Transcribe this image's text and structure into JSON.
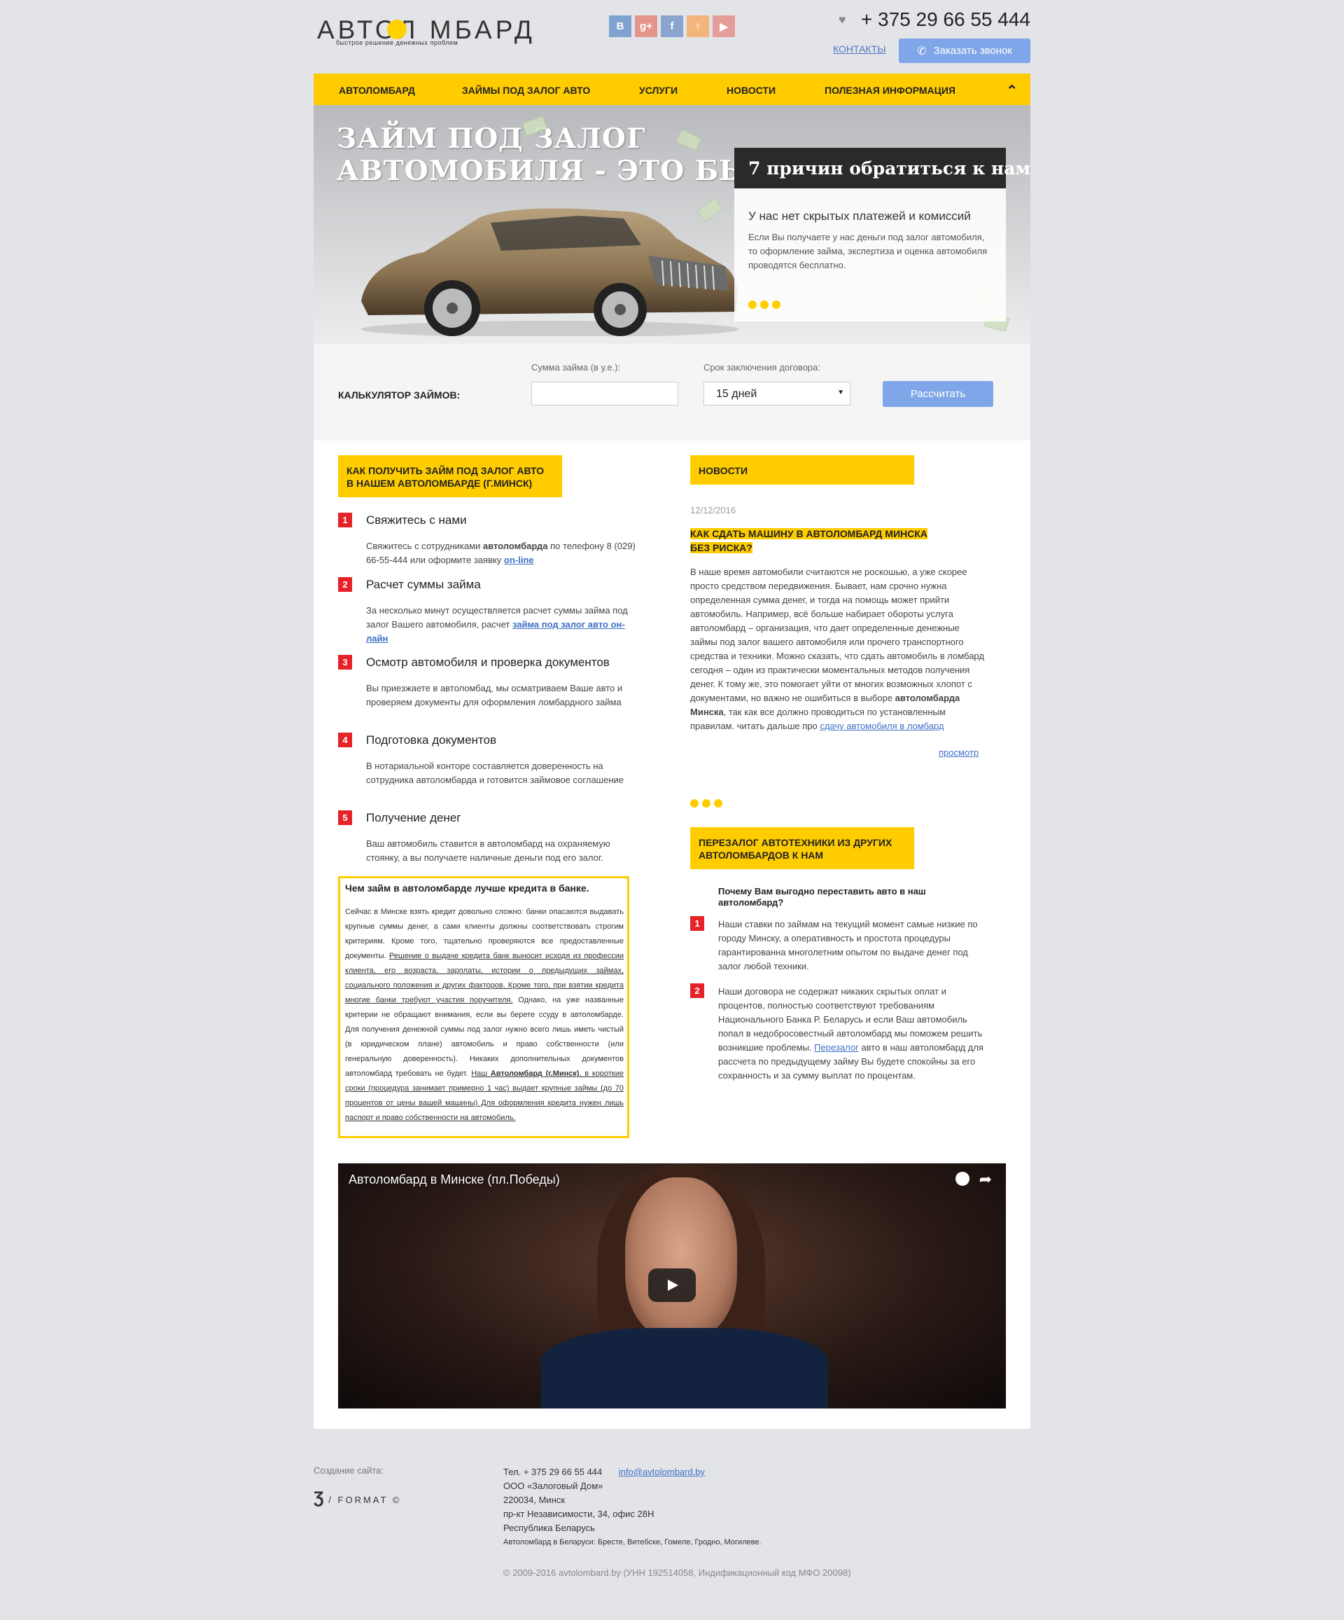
{
  "header": {
    "logo_text": "АВТОЛ  МБАРД",
    "logo_slogan": "быстрое решение денежных проблем",
    "social": [
      "В",
      "g+",
      "f",
      "ok",
      "yt"
    ],
    "phone": "+ 375 29 66 55 444",
    "contacts_link": "КОНТАКТЫ",
    "callback_button": "Заказать звонок"
  },
  "nav": {
    "items": [
      "АВТОЛОМБАРД",
      "ЗАЙМЫ ПОД ЗАЛОГ АВТО",
      "УСЛУГИ",
      "НОВОСТИ",
      "ПОЛЕЗНАЯ ИНФОРМАЦИЯ"
    ]
  },
  "hero": {
    "title_line1": "ЗАЙМ ПОД ЗАЛОГ",
    "title_line2": "АВТОМОБИЛЯ - ЭТО БЫСТРО",
    "reasons_title": "7 причин обратиться к нам",
    "reason_head": "У нас нет скрытых платежей и комиссий",
    "reason_text": "Если Вы получаете у нас деньги под залог автомобиля, то оформление займа, экспертиза и оценка автомобиля проводятся бесплатно."
  },
  "calculator": {
    "label": "КАЛЬКУЛЯТОР ЗАЙМОВ:",
    "sum_label": "Сумма займа (в у.е.):",
    "sum_value": "",
    "term_label": "Срок заключения договора:",
    "term_value": "15 дней",
    "button": "Рассчитать"
  },
  "how": {
    "title_line1": "КАК ПОЛУЧИТЬ ЗАЙМ ПОД ЗАЛОГ АВТО",
    "title_line2": "В НАШЕМ АВТОЛОМБАРДЕ (Г.МИНСК)",
    "steps": [
      {
        "num": "1",
        "title": "Свяжитесь с нами"
      },
      {
        "num": "2",
        "title": "Расчет суммы займа"
      },
      {
        "num": "3",
        "title": "Осмотр автомобиля и проверка документов"
      },
      {
        "num": "4",
        "title": "Подготовка документов"
      },
      {
        "num": "5",
        "title": "Получение денег"
      }
    ],
    "step1_a": "Свяжитесь с сотрудниками ",
    "step1_b": "автоломбарда",
    "step1_c": " по телефону 8 (029) 66-55-444 или оформите заявку ",
    "step1_link": "on-line",
    "step2_a": "За несколько минут осуществляется расчет суммы займа под залог Вашего автомобиля, расчет ",
    "step2_link": "займа под залог авто он-лайн",
    "step3": "Вы приезжаете в автоломбад, мы осматриваем Ваше авто и проверяем документы для оформления ломбардного займа",
    "step4": "В нотариальной конторе составляется доверенность на сотрудника автоломбарда и готовится займовое соглашение",
    "step5": "Ваш автомобиль ставится в автоломбард на охраняемую стоянку, а вы получаете наличные деньги под его залог."
  },
  "bank": {
    "title": "Чем займ в автоломбарде лучше кредита в банке.",
    "p1": "Сейчас в Минске взять кредит довольно сложно: банки опасаются выдавать крупные суммы денег, а сами клиенты должны соответствовать строгим критериям. Кроме того, тщательно проверяются все предоставленные документы. ",
    "p1_u": "Решение о выдаче кредита банк выносит исходя из профессии клиента, его возраста, зарплаты, истории о предыдущих займах, социального положения и других факторов. Кроме того, при взятии кредита многие банки требуют участия поручителя.",
    "p2": " Однако, на уже названные критерии не обращают внимания, если вы берете ссуду в автоломбарде. Для получения денежной суммы под залог нужно всего лишь иметь чистый (в юридическом плане) автомобиль и право собственности (или генеральную доверенность). Никаких дополнительных документов автоломбард требовать не будет. ",
    "p3_u1": "Наш ",
    "p3_b": "Автоломбард (г.Минск)",
    "p3_u2": ", в короткие сроки (процедура занимает примерно 1 час) выдает крупные займы (до 70 процентов от цены вашей машины) Для оформления кредита нужен лишь паспорт и право собственности на автомобиль."
  },
  "news": {
    "header": "НОВОСТИ",
    "date": "12/12/2016",
    "title": "КАК СДАТЬ МАШИНУ В АВТОЛОМБАРД МИНСКА БЕЗ РИСКА?",
    "text_a": "В наше время автомобили считаются не роскошью, а уже скорее просто средством передвижения. Бывает, нам срочно нужна определенная сумма денег, и тогда на помощь может прийти автомобиль. Например, всё больше набирает обороты услуга автоломбард – организация, что дает определенные денежные займы под залог вашего автомобиля или прочего транспортного средства и техники. Можно сказать, что сдать автомобиль в ломбард сегодня – один из практически моментальных методов получения денег. К тому же, это помогает уйти от многих возможных хлопот с документами, но важно не ошибиться в выборе ",
    "text_b": "автоломбарда Минска",
    "text_c": ", так как все должно проводиться по установленным правилам. читать дальше про ",
    "text_link": "сдачу автомобиля в ломбард",
    "more": "просмотр"
  },
  "rezalog": {
    "title_line1": "ПЕРЕЗАЛОГ АВТОТЕХНИКИ ИЗ ДРУГИХ",
    "title_line2": "АВТОЛОМБАРДОВ К НАМ",
    "question": "Почему Вам выгодно переставить авто в наш автоломбард?",
    "item1_num": "1",
    "item1": "Наши ставки по займам на текущий момент самые низкие по городу Минску, а оперативность и простота процедуры гарантированна многолетним опытом по выдаче денег под залог любой техники.",
    "item2_num": "2",
    "item2_a": "Наши договора не содержат никаких скрытых оплат и процентов, полностью соответствуют требованиям Национального Банка Р. Беларусь и если Ваш автомобиль попал в недобросовестный автоломбард мы поможем решить возникшие проблемы. ",
    "item2_link": "Перезалог",
    "item2_b": " авто в наш автоломбард для рассчета по предыдущему займу Вы будете спокойны за его сохранность и за сумму выплат по процентам."
  },
  "video": {
    "title": "Автоломбард в Минске (пл.Победы)"
  },
  "footer": {
    "created_label": "Создание сайта:",
    "creator": "FORMAT",
    "tel_label": "Тел.",
    "tel": "+ 375 29 66 55 444",
    "email": "info@avtolombard.by",
    "company": "ООО «Залоговый Дом»",
    "zip_city": "220034, Минск",
    "street": "пр-кт Независимости, 34, офис 28Н",
    "country": "Республика Беларусь",
    "cities": "Автоломбард в Беларуси: Бресте, Витебске, Гомеле, Гродно, Могилеве.",
    "copyright": "© 2009-2016 avtolombard.by (УНН 192514058, Индификационный код МФО 20098)"
  },
  "colors": {
    "accent_yellow": "#ffcc00",
    "button_blue": "#7fa6e8",
    "step_red": "#e62229",
    "link_blue": "#3e6fc4"
  }
}
